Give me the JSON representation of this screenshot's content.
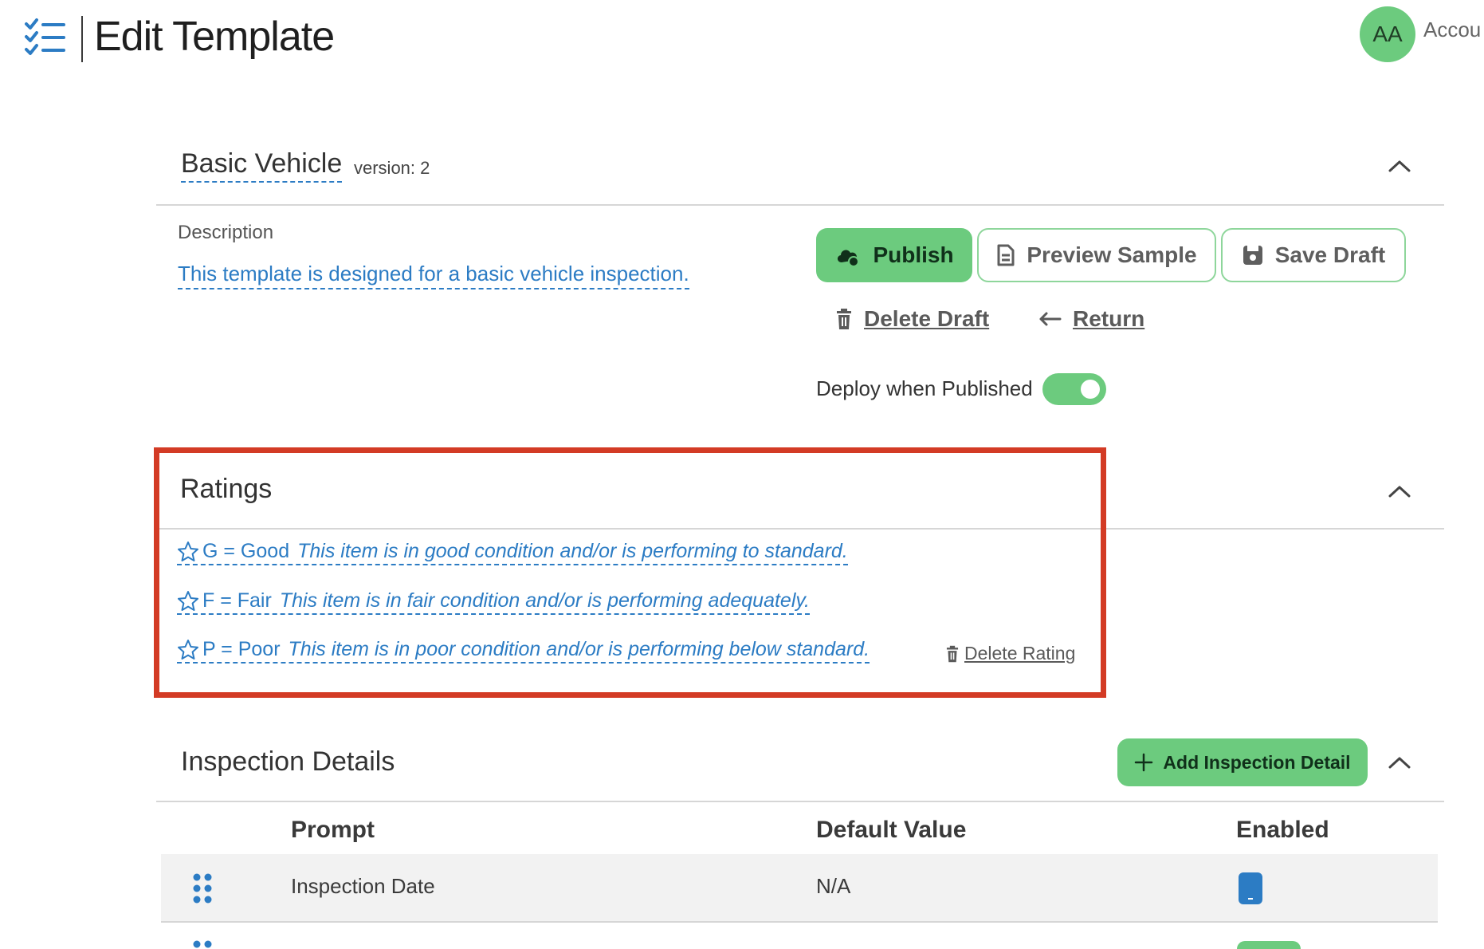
{
  "header": {
    "title": "Edit Template",
    "avatar_initials": "AA",
    "account_label": "Accou"
  },
  "template": {
    "name": "Basic Vehicle",
    "version_label": "version: 2",
    "description_label": "Description",
    "description": "This template is designed for a basic vehicle inspection."
  },
  "actions": {
    "publish": "Publish",
    "preview_sample": "Preview Sample",
    "save_draft": "Save Draft",
    "delete_draft": "Delete Draft",
    "return": "Return",
    "deploy_label": "Deploy when Published",
    "deploy_enabled": true
  },
  "ratings": {
    "title": "Ratings",
    "items": [
      {
        "code": "G = Good",
        "text": "This item is in good condition and/or is performing to standard."
      },
      {
        "code": "F = Fair",
        "text": "This item is in fair condition and/or is performing adequately."
      },
      {
        "code": "P = Poor",
        "text": "This item is in poor condition and/or is performing below standard."
      }
    ],
    "delete_label": "Delete Rating"
  },
  "inspection": {
    "title": "Inspection Details",
    "add_button": "Add Inspection Detail",
    "columns": [
      "Prompt",
      "Default Value",
      "Enabled"
    ],
    "rows": [
      {
        "prompt": "Inspection Date",
        "default_value": "N/A",
        "enabled": true
      }
    ]
  },
  "colors": {
    "accent_green": "#6ccb7e",
    "link_blue": "#2c7cc4",
    "highlight_red": "#d33b25"
  }
}
